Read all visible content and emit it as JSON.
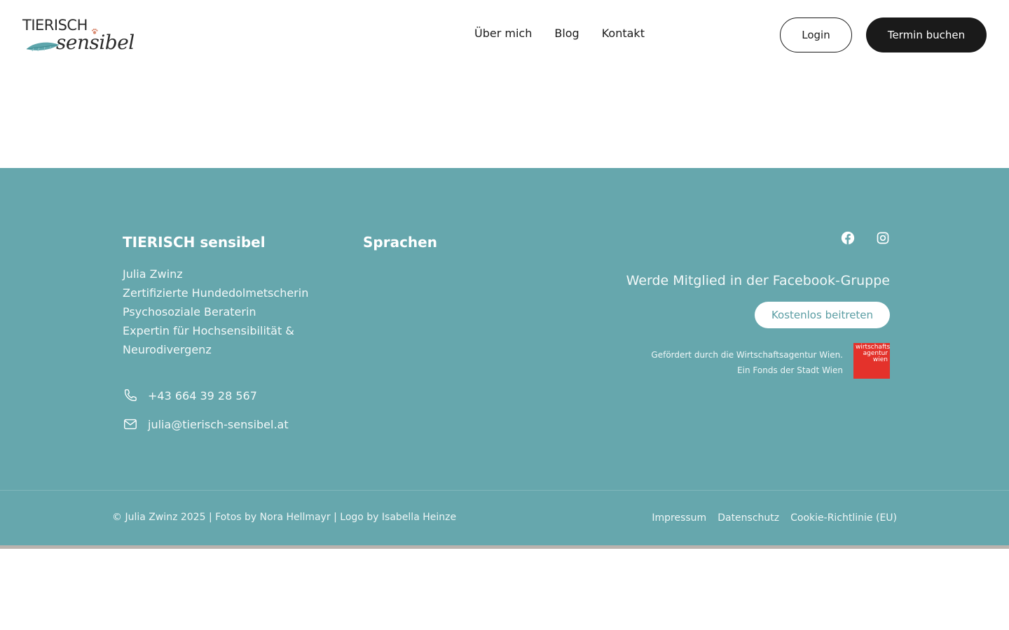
{
  "header": {
    "logo_top": "TIERISCH",
    "logo_script": "sensibel",
    "nav": [
      {
        "label": "Über mich"
      },
      {
        "label": "Blog"
      },
      {
        "label": "Kontakt"
      }
    ],
    "login_label": "Login",
    "book_label": "Termin buchen"
  },
  "footer": {
    "col1": {
      "title": "TIERISCH sensibel",
      "lines": [
        "Julia Zwinz",
        "Zertifizierte Hundedolmetscherin",
        "Psychosoziale Beraterin",
        "Expertin für Hochsensibilität &",
        "Neurodivergenz"
      ],
      "phone": "+43 664 39 28 567",
      "email": "julia@tierisch-sensibel.at"
    },
    "col2": {
      "title": "Sprachen"
    },
    "social": {
      "fb_group_text": "Werde Mitglied in der Facebook-Gruppe",
      "join_label": "Kostenlos beitreten",
      "sponsor_line1": "Gefördert durch die Wirtschaftsagentur Wien.",
      "sponsor_line2": "Ein Fonds der Stadt Wien",
      "sponsor_logo_line1": "wirtschafts",
      "sponsor_logo_line2": "agentur",
      "sponsor_logo_line3": "wien"
    },
    "copyright": "© Julia Zwinz 2025 | Fotos by Nora Hellmayr | Logo by Isabella Heinze",
    "legal": [
      {
        "label": "Impressum"
      },
      {
        "label": "Datenschutz"
      },
      {
        "label": "Cookie-Richtlinie (EU)"
      }
    ]
  },
  "colors": {
    "footer_bg": "#66a7ad",
    "dark_button": "#1a1a1a",
    "sponsor_red": "#e4322b"
  }
}
